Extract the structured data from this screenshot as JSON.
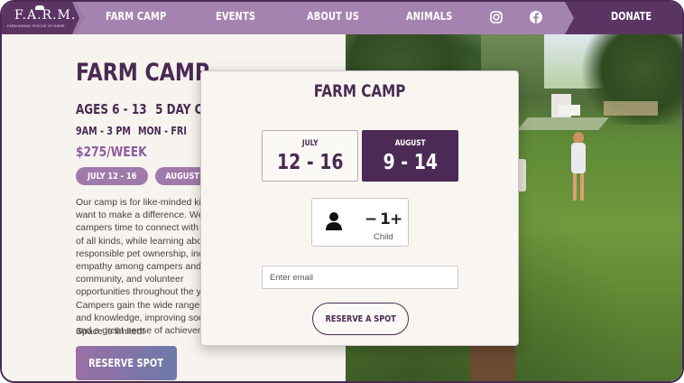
{
  "nav": {
    "logo": {
      "text": "F.A.R.M.",
      "subtitle": "FARM ANIMAL RESCUE OF MAINE"
    },
    "items": [
      {
        "label": "FARM CAMP"
      },
      {
        "label": "EVENTS"
      },
      {
        "label": "ABOUT US"
      },
      {
        "label": "ANIMALS"
      }
    ],
    "social_icons": [
      "instagram-icon",
      "facebook-icon"
    ],
    "donate_label": "DONATE"
  },
  "page": {
    "title": "FARM CAMP",
    "ages": "AGES 6 - 13",
    "duration": "5 DAY CAMP",
    "hours": "9AM - 3 PM",
    "days": "MON - FRI",
    "price": "$275/WEEK",
    "session_pills": [
      "JULY 12 - 16",
      "AUGUST 9 - 14"
    ],
    "description": "Our camp is for like-minded kids who want to make a difference. We give campers time to connect with animals of all kinds, while learning about responsible pet ownership, increased empathy among campers and community, and volunteer opportunities throughout the year. Campers gain the wide range of skills and knowledge, improving social skills and a great sense of achievement.",
    "limited": "Space is limited!",
    "reserve_label": "RESERVE SPOT"
  },
  "modal": {
    "title": "FARM CAMP",
    "dates": [
      {
        "month": "JULY",
        "range": "12 - 16",
        "selected": false
      },
      {
        "month": "AUGUST",
        "range": "9 - 14",
        "selected": true
      }
    ],
    "counter": {
      "minus": "−",
      "value": "1",
      "plus": "+",
      "label": "Child"
    },
    "email_placeholder": "Enter email",
    "reserve_label": "RESERVE A SPOT"
  },
  "colors": {
    "brand_dark": "#4a2a52",
    "brand_mid": "#a583b0",
    "accent_price": "#8e5da0",
    "selected_date": "#4b2a55"
  }
}
